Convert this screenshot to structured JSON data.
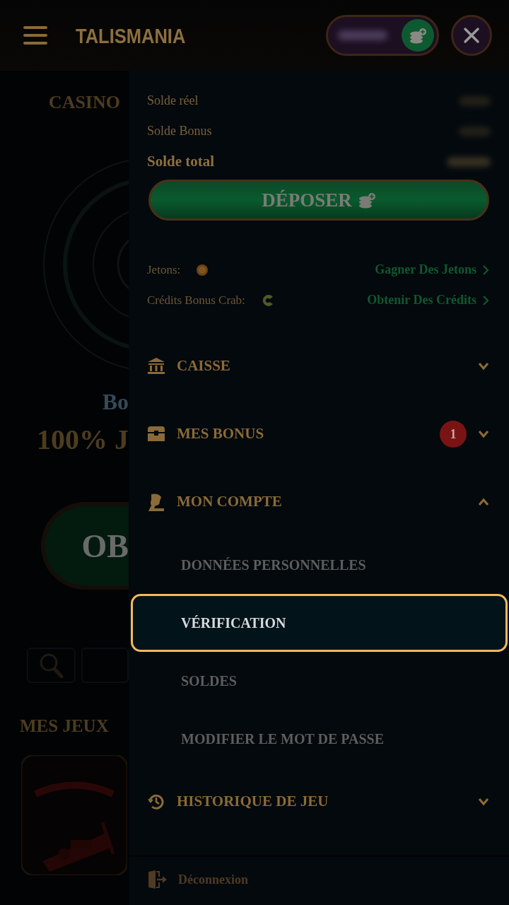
{
  "header": {
    "logo": "TALISMANIA"
  },
  "background_page": {
    "section_title": "CASINO",
    "banner_line_1": "Bo",
    "banner_line_2": "100% J",
    "banner_button": "OB",
    "games_heading": "MES JEUX"
  },
  "balances": [
    {
      "label": "Solde réel",
      "emphasis": false
    },
    {
      "label": "Solde Bonus",
      "emphasis": false
    },
    {
      "label": "Solde total",
      "emphasis": true
    }
  ],
  "deposit_button": "DÉPOSER",
  "rewards": [
    {
      "kind": "coin",
      "label": "Jetons:",
      "link": "Gagner Des Jetons"
    },
    {
      "kind": "crab",
      "label": "Crédits Bonus Crab:",
      "link": "Obtenir Des Crédits"
    }
  ],
  "menu": [
    {
      "kind": "bank",
      "label": "CAISSE",
      "expanded": false
    },
    {
      "kind": "chest",
      "label": "MES BONUS",
      "badge": "1",
      "expanded": false
    },
    {
      "kind": "person",
      "label": "MON COMPTE",
      "expanded": true,
      "children": [
        {
          "label": "DONNÉES PERSONNELLES",
          "selected": false
        },
        {
          "label": "VÉRIFICATION",
          "selected": true
        },
        {
          "label": "SOLDES",
          "selected": false
        },
        {
          "label": "MODIFIER LE MOT DE PASSE",
          "selected": false
        }
      ]
    },
    {
      "kind": "history",
      "label": "HISTORIQUE DE JEU",
      "expanded": false
    }
  ],
  "logout": "Déconnexion"
}
